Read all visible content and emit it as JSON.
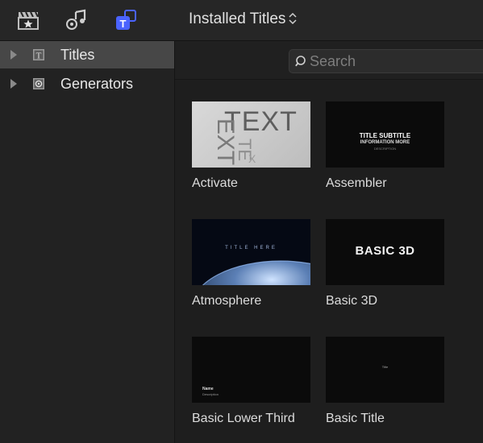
{
  "header": {
    "library_title": "Installed Titles",
    "sort_chevron": "⌃⌄"
  },
  "toolbar": {
    "icons": [
      "movies-icon",
      "music-icon",
      "titles-generators-icon"
    ],
    "active_icon": "titles-generators-icon",
    "active_color": "#4a63ff"
  },
  "sidebar": {
    "items": [
      {
        "label": "Titles",
        "icon": "titles-icon",
        "selected": true
      },
      {
        "label": "Generators",
        "icon": "generators-icon",
        "selected": false
      }
    ]
  },
  "search": {
    "placeholder": "Search",
    "value": ""
  },
  "tiles": [
    {
      "label": "Activate",
      "thumb_text": "TEXT"
    },
    {
      "label": "Assembler",
      "thumb_line1": "TITLE SUBTITLE",
      "thumb_line2": "INFORMATION MORE",
      "thumb_line3": "DESCRIPTION"
    },
    {
      "label": "Atmosphere",
      "thumb_text": "TITLE HERE"
    },
    {
      "label": "Basic 3D",
      "thumb_text": "BASIC 3D"
    },
    {
      "label": "Basic Lower Third",
      "thumb_line1": "Name",
      "thumb_line2": "Description"
    },
    {
      "label": "Basic Title",
      "thumb_text": "Title"
    }
  ]
}
